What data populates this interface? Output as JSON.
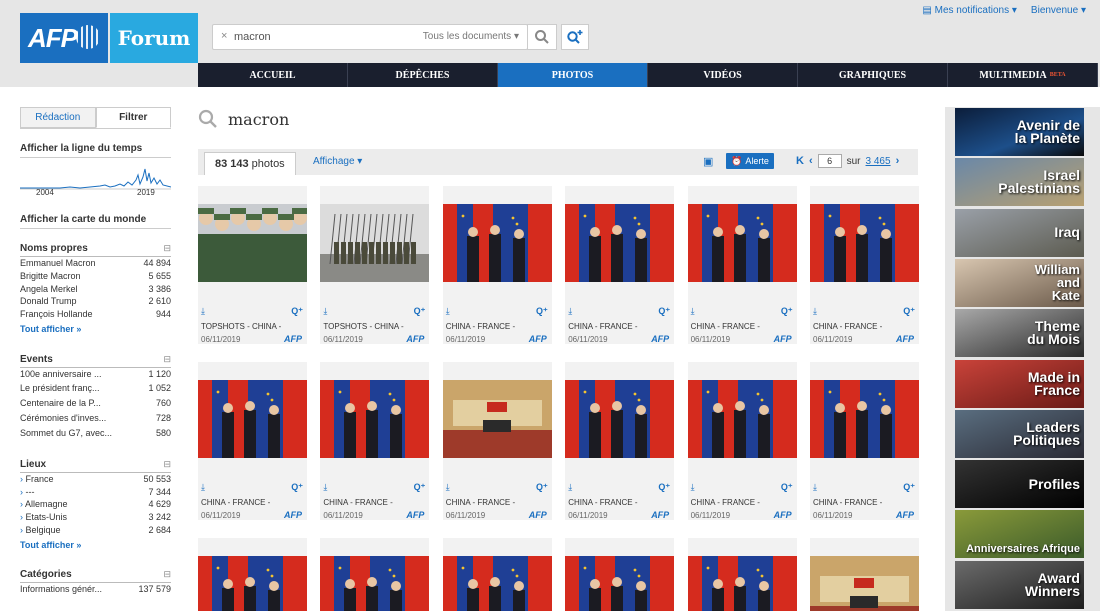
{
  "header": {
    "logo_afp": "AFP",
    "logo_forum": "Forum",
    "search_clear": "×",
    "search_value": "macron",
    "doc_select": "Tous les documents",
    "notifications": "Mes notifications",
    "welcome": "Bienvenue"
  },
  "nav": [
    "ACCUEIL",
    "DÉPÊCHES",
    "PHOTOS",
    "VIDÉOS",
    "GRAPHIQUES",
    "MULTIMEDIA"
  ],
  "nav_beta": "BETA",
  "nav_active": "PHOTOS",
  "sidebar": {
    "tab_redaction": "Rédaction",
    "tab_filtrer": "Filtrer",
    "timeline_link": "Afficher la ligne du temps",
    "timeline_start": "2004",
    "timeline_end": "2019",
    "map_link": "Afficher la carte du monde",
    "facets": {
      "noms": {
        "title": "Noms propres",
        "rows": [
          {
            "label": "Emmanuel Macron",
            "count": "44 894"
          },
          {
            "label": "Brigitte Macron",
            "count": "5 655"
          },
          {
            "label": "Angela Merkel",
            "count": "3 386"
          },
          {
            "label": "Donald Trump",
            "count": "2 610"
          },
          {
            "label": "François Hollande",
            "count": "944"
          }
        ],
        "show_all": "Tout afficher »"
      },
      "events": {
        "title": "Events",
        "rows": [
          {
            "label": "100e anniversaire ...",
            "count": "1 120"
          },
          {
            "label": "Le président franç...",
            "count": "1 052"
          },
          {
            "label": "Centenaire de la P...",
            "count": "760"
          },
          {
            "label": "Cérémonies d'inves...",
            "count": "728"
          },
          {
            "label": "Sommet du G7, avec...",
            "count": "580"
          }
        ]
      },
      "lieux": {
        "title": "Lieux",
        "rows": [
          {
            "label": "France",
            "count": "50 553"
          },
          {
            "label": "---",
            "count": "7 344"
          },
          {
            "label": "Allemagne",
            "count": "4 629"
          },
          {
            "label": "Etats-Unis",
            "count": "3 242"
          },
          {
            "label": "Belgique",
            "count": "2 684"
          }
        ],
        "show_all": "Tout afficher »"
      },
      "categories": {
        "title": "Catégories",
        "rows": [
          {
            "label": "Informations génér...",
            "count": "137 579"
          }
        ]
      }
    }
  },
  "main": {
    "query": "macron",
    "count": "83 143",
    "count_unit": "photos",
    "affichage": "Affichage",
    "alerte": "Alerte",
    "page": "6",
    "of": "sur",
    "total_pages": "3 465",
    "cards": [
      {
        "caption": "TOPSHOTS - CHINA -",
        "date": "06/11/2019",
        "tone": "soldiers"
      },
      {
        "caption": "TOPSHOTS - CHINA -",
        "date": "06/11/2019",
        "tone": "guards"
      },
      {
        "caption": "CHINA - FRANCE -",
        "date": "06/11/2019",
        "tone": "flags"
      },
      {
        "caption": "CHINA - FRANCE -",
        "date": "06/11/2019",
        "tone": "flags"
      },
      {
        "caption": "CHINA - FRANCE -",
        "date": "06/11/2019",
        "tone": "flags"
      },
      {
        "caption": "CHINA - FRANCE -",
        "date": "06/11/2019",
        "tone": "flags"
      },
      {
        "caption": "CHINA - FRANCE -",
        "date": "06/11/2019",
        "tone": "flags"
      },
      {
        "caption": "CHINA - FRANCE -",
        "date": "06/11/2019",
        "tone": "flags"
      },
      {
        "caption": "CHINA - FRANCE -",
        "date": "06/11/2019",
        "tone": "hall"
      },
      {
        "caption": "CHINA - FRANCE -",
        "date": "06/11/2019",
        "tone": "flags"
      },
      {
        "caption": "CHINA - FRANCE -",
        "date": "06/11/2019",
        "tone": "flags"
      },
      {
        "caption": "CHINA - FRANCE -",
        "date": "06/11/2019",
        "tone": "flags"
      }
    ],
    "agency": "AFP"
  },
  "promos": [
    [
      "Avenir de",
      "la Planète"
    ],
    [
      "Israel",
      "Palestinians"
    ],
    [
      "Iraq"
    ],
    [
      "William",
      "and",
      "Kate"
    ],
    [
      "Theme",
      "du Mois"
    ],
    [
      "Made in",
      "France"
    ],
    [
      "Leaders",
      "Politiques"
    ],
    [
      "Profiles"
    ],
    [
      "Anniversaires Afrique"
    ],
    [
      "Award",
      "Winners"
    ]
  ],
  "colors": {
    "accent": "#1a6fc0",
    "nav_dark": "#1a1f2e",
    "forum": "#29a9e0"
  }
}
